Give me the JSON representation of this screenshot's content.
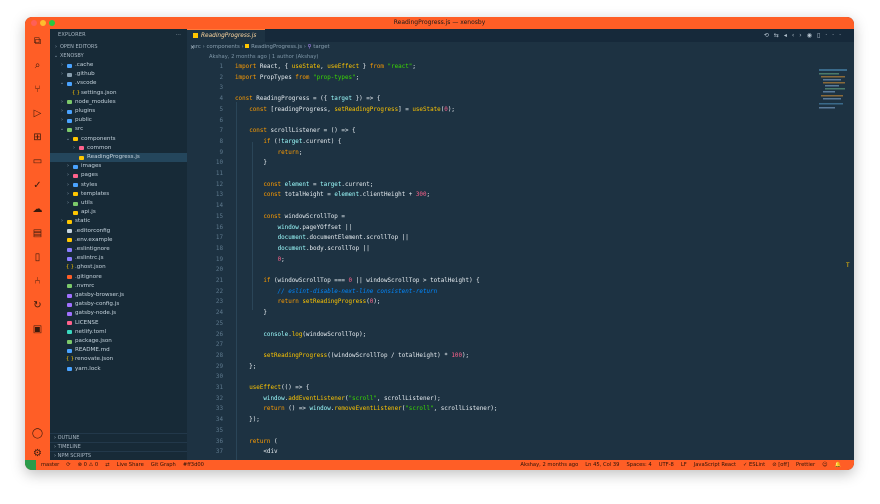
{
  "window": {
    "title": "ReadingProgress.js — xenosby",
    "traffic_colors": [
      "#ff5f57",
      "#febc2e",
      "#28c840"
    ]
  },
  "explorer": {
    "header": "EXPLORER",
    "more": "···",
    "open_editors": "OPEN EDITORS",
    "root": "XENOSBY",
    "items": [
      {
        "label": ".cache",
        "indent": 1,
        "chev": ">",
        "color": "#4aa3ff"
      },
      {
        "label": ".github",
        "indent": 1,
        "chev": ">",
        "color": "#8aa0b0"
      },
      {
        "label": ".vscode",
        "indent": 1,
        "chev": "v",
        "color": "#4aa3ff"
      },
      {
        "label": "settings.json",
        "indent": 2,
        "chev": "",
        "color": "#ffc600",
        "glyph": "{ }"
      },
      {
        "label": "node_modules",
        "indent": 1,
        "chev": ">",
        "color": "#7cc96a"
      },
      {
        "label": "plugins",
        "indent": 1,
        "chev": ">",
        "color": "#4aa3ff"
      },
      {
        "label": "public",
        "indent": 1,
        "chev": ">",
        "color": "#4aa3ff"
      },
      {
        "label": "src",
        "indent": 1,
        "chev": "v",
        "color": "#7cc96a"
      },
      {
        "label": "components",
        "indent": 2,
        "chev": "v",
        "color": "#ffc600"
      },
      {
        "label": "common",
        "indent": 3,
        "chev": ">",
        "color": "#ff628c"
      },
      {
        "label": "ReadingProgress.js",
        "indent": 3,
        "chev": "",
        "color": "#ffc600",
        "selected": true
      },
      {
        "label": "images",
        "indent": 2,
        "chev": ">",
        "color": "#4aa3ff"
      },
      {
        "label": "pages",
        "indent": 2,
        "chev": ">",
        "color": "#ff628c"
      },
      {
        "label": "styles",
        "indent": 2,
        "chev": ">",
        "color": "#4aa3ff"
      },
      {
        "label": "templates",
        "indent": 2,
        "chev": ">",
        "color": "#ffc600"
      },
      {
        "label": "utils",
        "indent": 2,
        "chev": ">",
        "color": "#7cc96a"
      },
      {
        "label": "api.js",
        "indent": 2,
        "chev": "",
        "color": "#ffc600"
      },
      {
        "label": "static",
        "indent": 1,
        "chev": ">",
        "color": "#ffc600"
      },
      {
        "label": ".editorconfig",
        "indent": 1,
        "chev": "",
        "color": "#c6d4de"
      },
      {
        "label": ".env.example",
        "indent": 1,
        "chev": "",
        "color": "#ffc600"
      },
      {
        "label": ".eslintignore",
        "indent": 1,
        "chev": "",
        "color": "#8a7cff"
      },
      {
        "label": ".eslintrc.js",
        "indent": 1,
        "chev": "",
        "color": "#8a7cff"
      },
      {
        "label": ".ghost.json",
        "indent": 1,
        "chev": "",
        "color": "#ffc600",
        "glyph": "{ }"
      },
      {
        "label": ".gitignore",
        "indent": 1,
        "chev": "",
        "color": "#ff5e26"
      },
      {
        "label": ".nvmrc",
        "indent": 1,
        "chev": "",
        "color": "#7cc96a"
      },
      {
        "label": "gatsby-browser.js",
        "indent": 1,
        "chev": "",
        "color": "#a070ff"
      },
      {
        "label": "gatsby-config.js",
        "indent": 1,
        "chev": "",
        "color": "#a070ff"
      },
      {
        "label": "gatsby-node.js",
        "indent": 1,
        "chev": "",
        "color": "#a070ff"
      },
      {
        "label": "LICENSE",
        "indent": 1,
        "chev": "",
        "color": "#ff628c"
      },
      {
        "label": "netlify.toml",
        "indent": 1,
        "chev": "",
        "color": "#3ad9c0"
      },
      {
        "label": "package.json",
        "indent": 1,
        "chev": "",
        "color": "#7cc96a"
      },
      {
        "label": "README.md",
        "indent": 1,
        "chev": "",
        "color": "#4aa3ff"
      },
      {
        "label": "renovate.json",
        "indent": 1,
        "chev": "",
        "color": "#ffc600",
        "glyph": "{ }"
      },
      {
        "label": "yarn.lock",
        "indent": 1,
        "chev": "",
        "color": "#4aa3ff"
      }
    ],
    "sections": [
      "OUTLINE",
      "TIMELINE",
      "NPM SCRIPTS"
    ]
  },
  "editor": {
    "tab_label": "ReadingProgress.js",
    "tab_close": "×",
    "toolbar_icons": [
      "history-icon",
      "compare-icon",
      "go-back-icon",
      "prev-change-icon",
      "next-change-icon",
      "source-control-icon",
      "split-editor-icon",
      "more-icon"
    ],
    "toolbar_glyphs": [
      "⟲",
      "⇆",
      "◂",
      "‹",
      "›",
      "◉",
      "▯",
      "···"
    ],
    "breadcrumb": [
      "src",
      "components",
      "ReadingProgress.js",
      "target"
    ],
    "blame": "Akshay, 2 months ago | 1 author (Akshay)",
    "lines": [
      {
        "n": "1",
        "code": "import React, { useState, useEffect } from \"react\";"
      },
      {
        "n": "2",
        "code": "import PropTypes from \"prop-types\";"
      },
      {
        "n": "3",
        "code": ""
      },
      {
        "n": "4",
        "code": "const ReadingProgress = ({ target }) => {"
      },
      {
        "n": "5",
        "code": "    const [readingProgress, setReadingProgress] = useState(0);"
      },
      {
        "n": "6",
        "code": ""
      },
      {
        "n": "7",
        "code": "    const scrollListener = () => {"
      },
      {
        "n": "8",
        "code": "        if (!target.current) {"
      },
      {
        "n": "9",
        "code": "            return;"
      },
      {
        "n": "10",
        "code": "        }"
      },
      {
        "n": "11",
        "code": ""
      },
      {
        "n": "12",
        "code": "        const element = target.current;"
      },
      {
        "n": "13",
        "code": "        const totalHeight = element.clientHeight + 300;"
      },
      {
        "n": "14",
        "code": ""
      },
      {
        "n": "15",
        "code": "        const windowScrollTop ="
      },
      {
        "n": "16",
        "code": "            window.pageYOffset ||"
      },
      {
        "n": "17",
        "code": "            document.documentElement.scrollTop ||"
      },
      {
        "n": "18",
        "code": "            document.body.scrollTop ||"
      },
      {
        "n": "19",
        "code": "            0;"
      },
      {
        "n": "20",
        "code": ""
      },
      {
        "n": "21",
        "code": "        if (windowScrollTop === 0 || windowScrollTop > totalHeight) {"
      },
      {
        "n": "22",
        "code": "            // eslint-disable-next-line consistent-return"
      },
      {
        "n": "23",
        "code": "            return setReadingProgress(0);"
      },
      {
        "n": "24",
        "code": "        }"
      },
      {
        "n": "25",
        "code": ""
      },
      {
        "n": "26",
        "code": "        console.log(windowScrollTop);"
      },
      {
        "n": "27",
        "code": ""
      },
      {
        "n": "28",
        "code": "        setReadingProgress((windowScrollTop / totalHeight) * 100);"
      },
      {
        "n": "29",
        "code": "    };"
      },
      {
        "n": "30",
        "code": ""
      },
      {
        "n": "31",
        "code": "    useEffect(() => {"
      },
      {
        "n": "32",
        "code": "        window.addEventListener(\"scroll\", scrollListener);"
      },
      {
        "n": "33",
        "code": "        return () => window.removeEventListener(\"scroll\", scrollListener);"
      },
      {
        "n": "34",
        "code": "    });"
      },
      {
        "n": "35",
        "code": ""
      },
      {
        "n": "36",
        "code": "    return ("
      },
      {
        "n": "37",
        "code": "        <div"
      }
    ]
  },
  "status": {
    "left": [
      "master",
      "⟳",
      "⊗ 0 ⚠ 0",
      "⇄",
      "Live Share",
      "Git Graph",
      "#ff3d00"
    ],
    "right": [
      "Akshay, 2 months ago",
      "Ln 45, Col 39",
      "Spaces: 4",
      "UTF-8",
      "LF",
      "JavaScript React",
      "✓ ESLint",
      "⊘ [off]",
      "Prettier",
      "☺",
      "🔔"
    ]
  },
  "edge_marker": "T"
}
